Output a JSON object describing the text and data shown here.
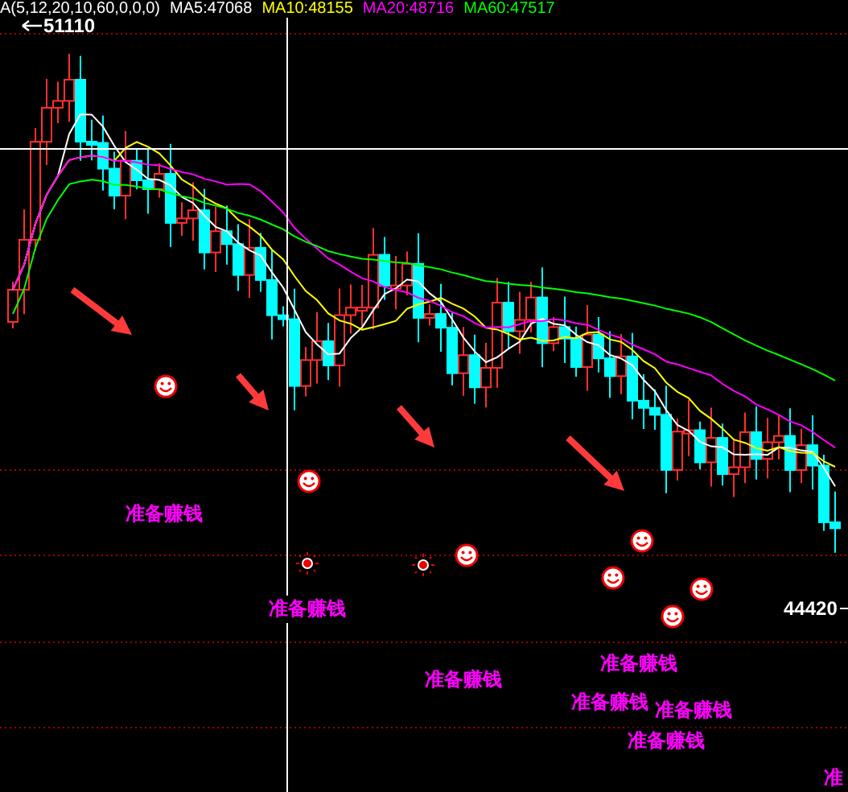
{
  "legend": [
    {
      "text": "A(5,12,20,10,60,0,0,0)",
      "color": "#ffffff"
    },
    {
      "text": "MA5:47068",
      "color": "#ffffff"
    },
    {
      "text": "MA10:48155",
      "color": "#ffff00"
    },
    {
      "text": "MA20:48716",
      "color": "#ff00ff"
    },
    {
      "text": "MA60:47517",
      "color": "#00ff00"
    }
  ],
  "price_labels": {
    "high": "51110",
    "low": "44420"
  },
  "signals": [
    "准备赚钱",
    "准备赚钱",
    "准备赚钱",
    "准备赚钱",
    "准备赚钱",
    "准备赚钱",
    "准备赚钱",
    "准"
  ]
}
